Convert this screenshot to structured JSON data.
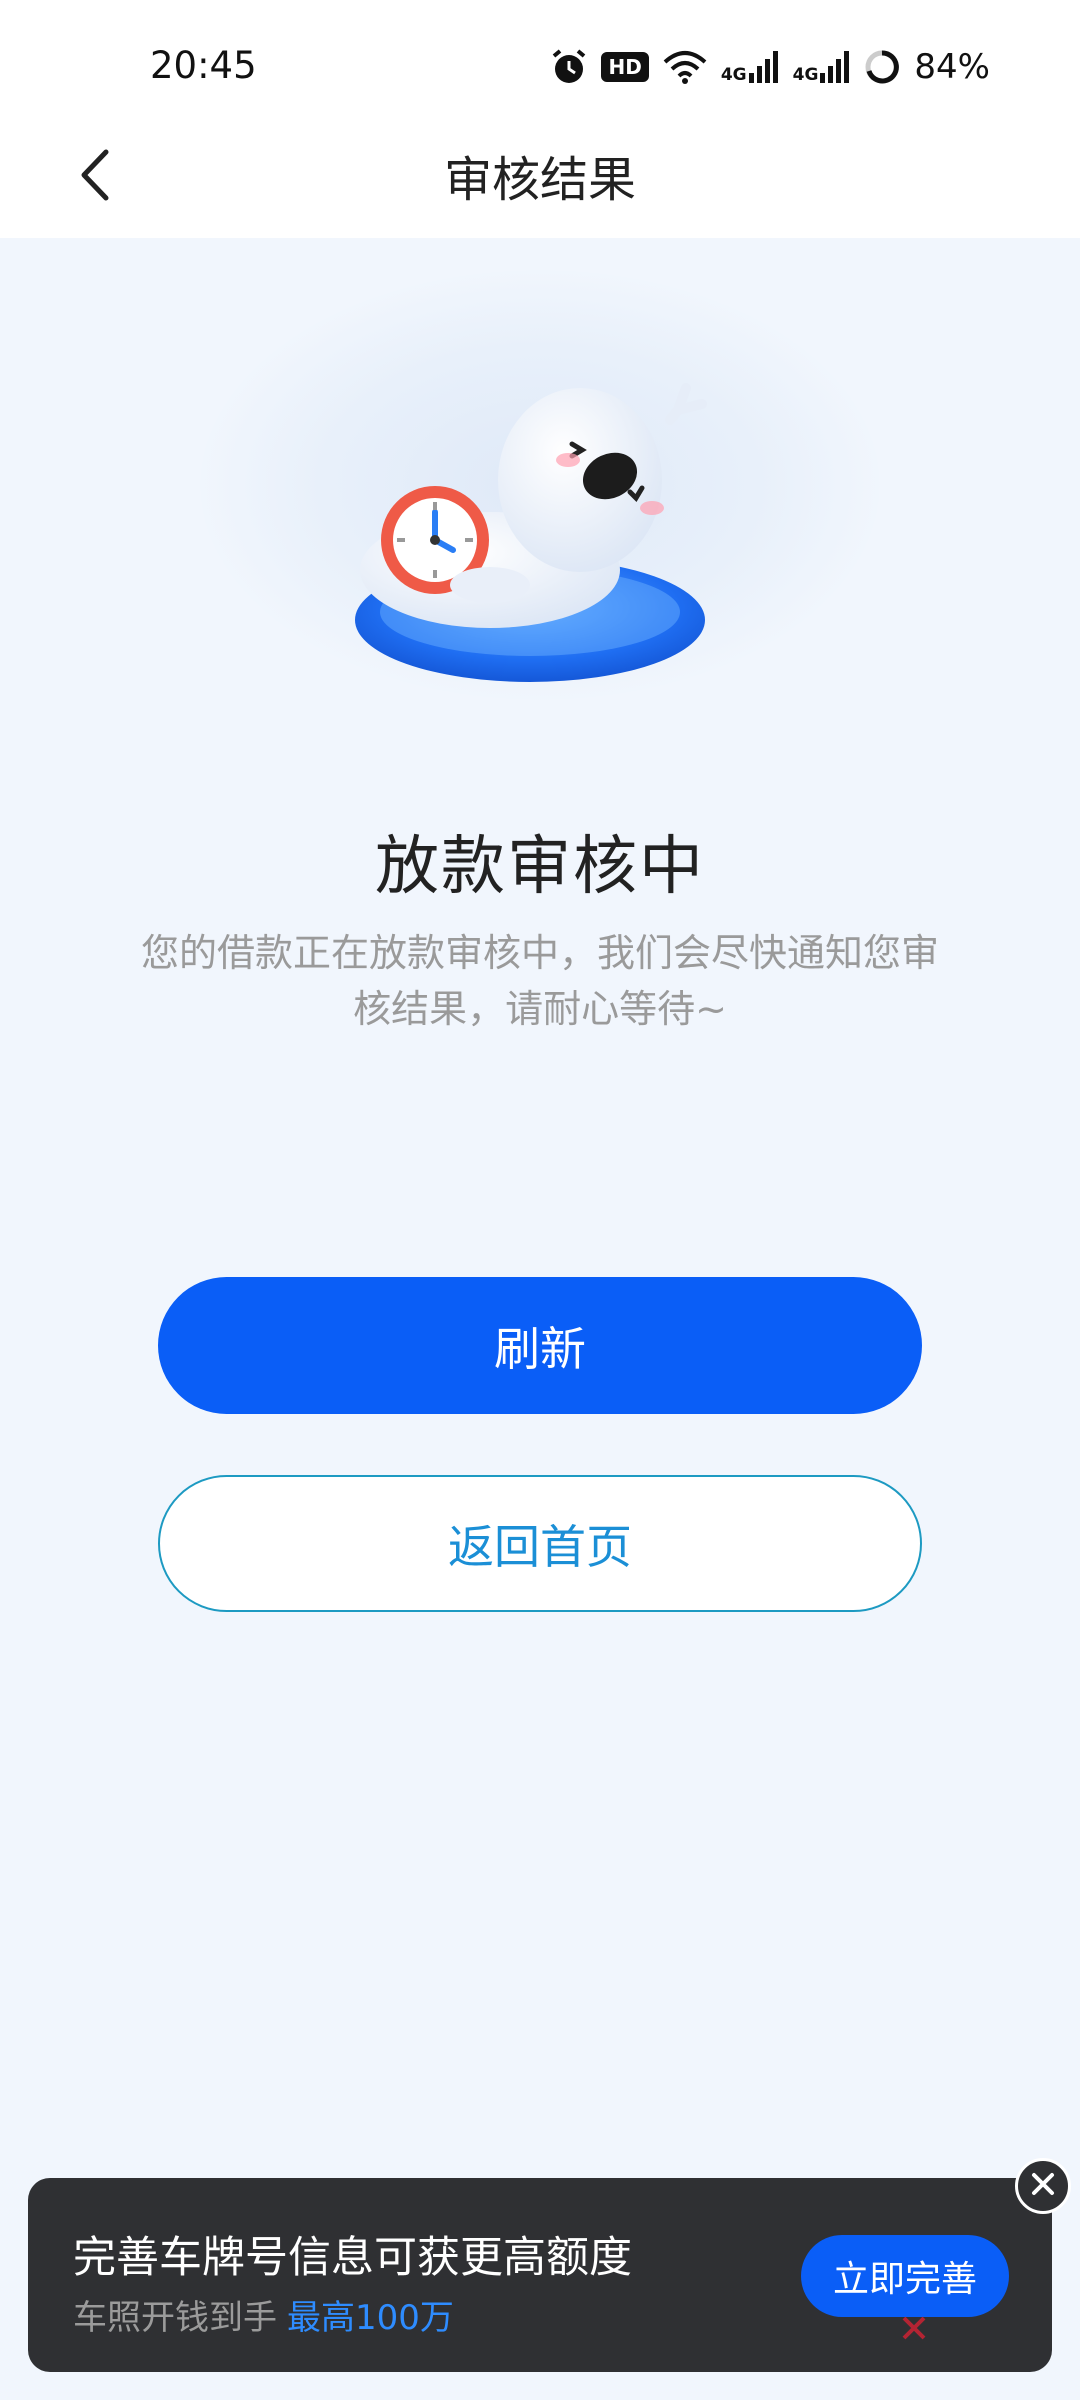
{
  "status_bar": {
    "time": "20:45",
    "hd_label": "HD",
    "net1": "4G",
    "net2": "4G",
    "battery": "84%",
    "icons": [
      "alarm-icon",
      "hd-icon",
      "wifi-icon",
      "signal-icon",
      "signal-icon",
      "battery-ring-icon"
    ]
  },
  "nav": {
    "title": "审核结果",
    "back_icon": "chevron-left-icon"
  },
  "hero": {
    "illustration": "sleeping-seal-with-clock"
  },
  "content": {
    "status_title": "放款审核中",
    "status_desc": "您的借款正在放款审核中，我们会尽快通知您审核结果，请耐心等待~"
  },
  "buttons": {
    "refresh_label": "刷新",
    "home_label": "返回首页"
  },
  "promo": {
    "title": "完善车牌号信息可获更高额度",
    "subtitle": "车照开钱到手",
    "highlight": "最高100万",
    "cta_label": "立即完善",
    "close_icon": "close-icon"
  },
  "colors": {
    "primary": "#0a5ef7",
    "secondary_text": "#1b8fd6",
    "page_bg": "#f1f6fd",
    "banner_bg": "#2f3033",
    "highlight": "#2e8cff"
  }
}
